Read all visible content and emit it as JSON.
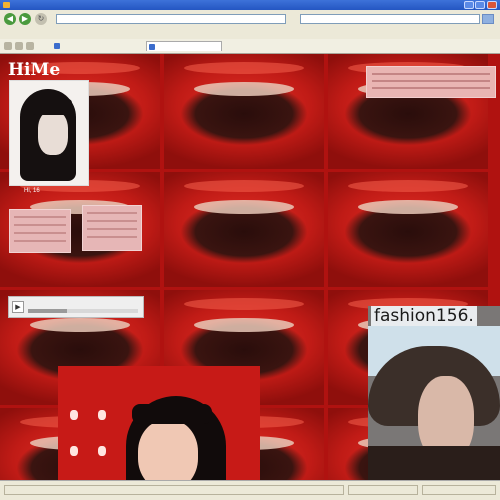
{
  "profile": {
    "site_title": "HiMe",
    "name_caption": "Hi, 16"
  },
  "page": {
    "fashion_heading": "fashion156."
  }
}
